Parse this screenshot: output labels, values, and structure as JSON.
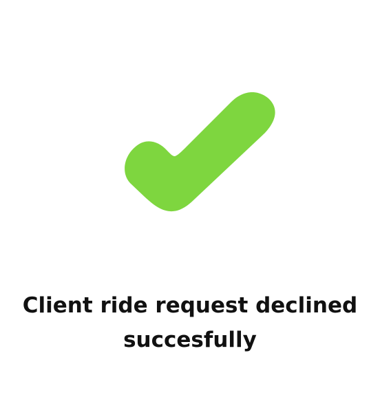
{
  "status": {
    "icon": "check-icon",
    "icon_color": "#7ED63F",
    "message_line_1": "Client ride request declined",
    "message_line_2": "succesfully"
  },
  "colors": {
    "background": "#FFFFFF",
    "text": "#111111"
  }
}
